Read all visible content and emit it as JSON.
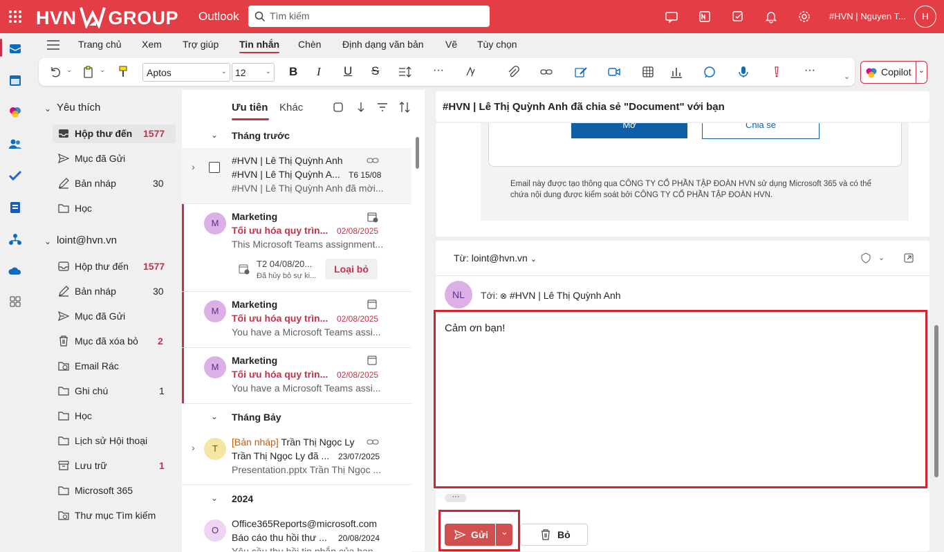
{
  "topbar": {
    "logo": "HVN",
    "logo_group": "GROUP",
    "app": "Outlook",
    "search_placeholder": "Tìm kiếm",
    "user": "#HVN | Nguyen T...",
    "avatar": "H",
    "color": "#e33e45"
  },
  "menu_tabs": [
    "Trang chủ",
    "Xem",
    "Trợ giúp",
    "Tin nhắn",
    "Chèn",
    "Định dạng văn bản",
    "Vẽ",
    "Tùy chọn"
  ],
  "active_tab": "Tin nhắn",
  "ribbon": {
    "font": "Aptos",
    "size": "12",
    "copilot": "Copilot"
  },
  "folders": {
    "favorites_title": "Yêu thích",
    "favorites": [
      {
        "label": "Hộp thư đến",
        "count": "1577",
        "bold": true
      },
      {
        "label": "Mục đã Gửi",
        "count": ""
      },
      {
        "label": "Bản nháp",
        "count": "30"
      },
      {
        "label": "Học",
        "count": ""
      }
    ],
    "account_title": "loint@hvn.vn",
    "account": [
      {
        "label": "Hộp thư đến",
        "count": "1577",
        "red": true
      },
      {
        "label": "Bản nháp",
        "count": "30"
      },
      {
        "label": "Mục đã Gửi",
        "count": ""
      },
      {
        "label": "Mục đã xóa bỏ",
        "count": "2",
        "red": true
      },
      {
        "label": "Email Rác",
        "count": ""
      },
      {
        "label": "Ghi chú",
        "count": "1"
      },
      {
        "label": "Học",
        "count": ""
      },
      {
        "label": "Lịch sử Hội thoại",
        "count": ""
      },
      {
        "label": "Lưu trữ",
        "count": "1",
        "red": true
      },
      {
        "label": "Microsoft 365",
        "count": ""
      },
      {
        "label": "Thư mục Tìm kiếm",
        "count": ""
      }
    ]
  },
  "list": {
    "tab_focused": "Ưu tiên",
    "tab_other": "Khác",
    "group1": "Tháng trước",
    "group2": "Tháng Bảy",
    "group3": "2024",
    "items": [
      {
        "from": "#HVN | Lê Thị Quỳnh Anh",
        "subject": "#HVN | Lê Thị Quỳnh A...",
        "date": "T6 15/08",
        "preview": "#HVN | Lê Thị Quỳnh Anh đã mời..."
      },
      {
        "from": "Marketing",
        "subject": "Tối ưu hóa quy trìn...",
        "date": "02/08/2025",
        "preview": "This Microsoft Teams assignment...",
        "avatar": "M",
        "event": "T2 04/08/20...",
        "event_sub": "Đã hủy bỏ sự ki...",
        "action": "Loại bỏ"
      },
      {
        "from": "Marketing",
        "subject": "Tối ưu hóa quy trìn...",
        "date": "02/08/2025",
        "preview": "You have a Microsoft Teams assi...",
        "avatar": "M"
      },
      {
        "from": "Marketing",
        "subject": "Tối ưu hóa quy trìn...",
        "date": "02/08/2025",
        "preview": "You have a Microsoft Teams assi...",
        "avatar": "M"
      },
      {
        "draft": "[Bản nháp]",
        "from": "Trần Thị Ngọc Ly",
        "subject": "Trần Thị Ngọc Ly đã ...",
        "date": "23/07/2025",
        "preview": "Presentation.pptx Trần Thị Ngọc ...",
        "avatar": "T"
      },
      {
        "from": "Office365Reports@microsoft.com",
        "subject": "Báo cáo thu hồi thư ...",
        "date": "20/08/2024",
        "preview": "Yêu cầu thu hồi tin nhắn của bạn",
        "avatar": "O"
      }
    ]
  },
  "reading": {
    "subject": "#HVN | Lê Thị Quỳnh Anh đã chia sẻ \"Document\" với bạn",
    "btn_open": "Mở",
    "btn_share": "Chia sẻ",
    "footer": "Email này được tạo thông qua CÔNG TY CỔ PHẦN TẬP ĐOÀN HVN sử dụng Microsoft 365 và có thể chứa nội dung được kiểm soát bởi CÔNG TY CỔ PHẦN TẬP ĐOÀN HVN."
  },
  "compose": {
    "from": "Từ: loint@hvn.vn",
    "avatar": "NL",
    "to_label": "Tới:",
    "to": "#HVN | Lê Thị Quỳnh Anh",
    "body": "Cảm ơn bạn!",
    "send": "Gửi",
    "discard": "Bỏ",
    "more": "···"
  }
}
